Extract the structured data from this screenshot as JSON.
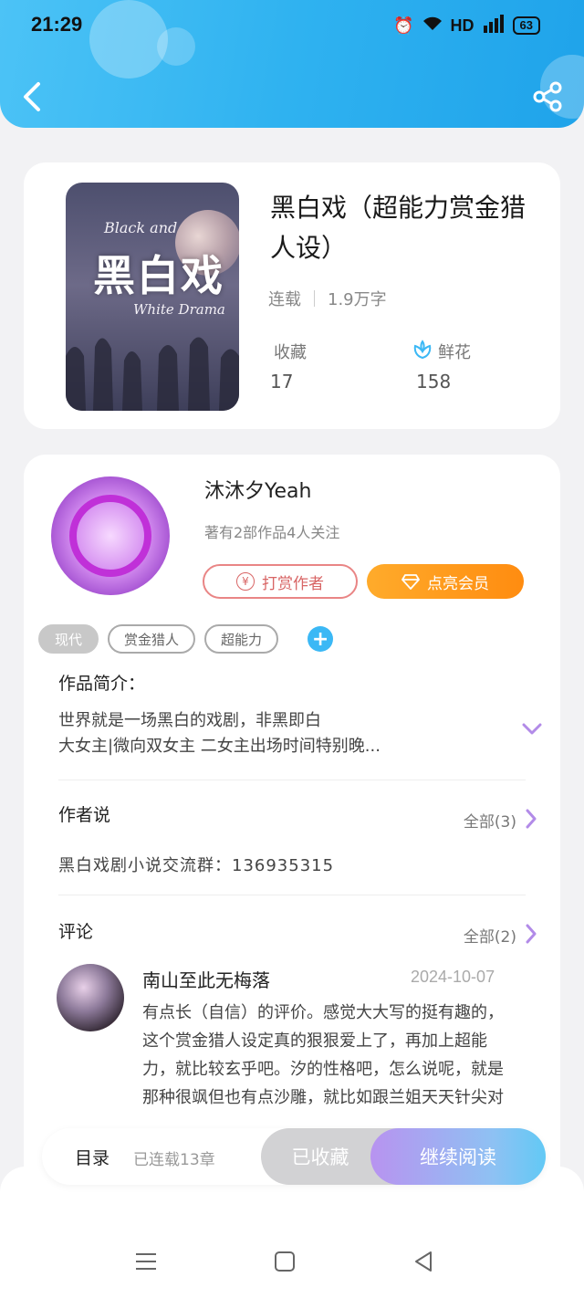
{
  "status_bar": {
    "time": "21:29",
    "network": "HD",
    "signal": "5G",
    "battery": "63"
  },
  "book": {
    "title": "黑白戏（超能力赏金猎人设）",
    "status": "连载",
    "word_count": "1.9万字",
    "collect_label": "收藏",
    "collect_count": "17",
    "flower_label": "鲜花",
    "flower_count": "158",
    "cover_text_en1": "Black and",
    "cover_text_cn": "黑白戏",
    "cover_text_en2": "White Drama"
  },
  "author": {
    "name": "沐沐夕Yeah",
    "stats": "著有2部作品4人关注",
    "tip_button": "打赏作者",
    "vip_button": "点亮会员"
  },
  "tags": [
    "现代",
    "赏金猎人",
    "超能力"
  ],
  "intro": {
    "title": "作品简介：",
    "line1": "世界就是一场黑白的戏剧，非黑即白",
    "line2": "大女主|微向双女主 二女主出场时间特别晚..."
  },
  "author_says": {
    "title": "作者说",
    "all_link": "全部(3)",
    "content": "黑白戏剧小说交流群：136935315"
  },
  "comments": {
    "title": "评论",
    "all_link": "全部(2)",
    "items": [
      {
        "user": "南山至此无梅落",
        "date": "2024-10-07",
        "text": "有点长（自信）的评价。感觉大大写的挺有趣的，这个赏金猎人设定真的狠狠爱上了，再加上超能力，就比较玄乎吧。汐的性格吧，怎么说呢，就是那种很飒但也有点沙雕，就比如跟兰姐天天针尖对麦芒，额对"
      }
    ]
  },
  "bottom_bar": {
    "toc": "目录",
    "toc_sub": "已连载13章",
    "collected": "已收藏",
    "continue": "继续阅读"
  },
  "colors": {
    "header": "#2fb2f0",
    "vip": "#ff8c10",
    "tip": "#d86565",
    "read_gradient_start": "#b893f0",
    "read_gradient_end": "#62c9f5",
    "chevron": "#b28be8"
  }
}
